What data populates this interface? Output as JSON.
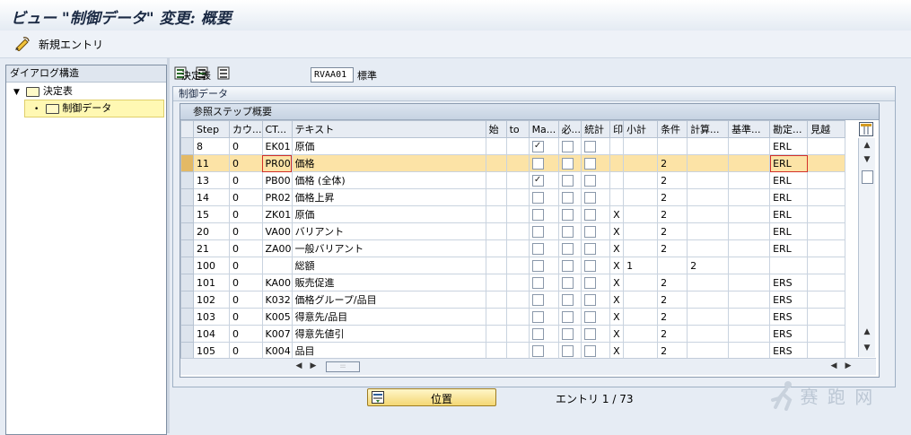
{
  "title": "ビュー \"制御データ\" 変更: 概要",
  "toolbar": {
    "new_entries": "新規エントリ",
    "icons": [
      "edit-pen-icon",
      "copy-icon",
      "delete-icon",
      "undo-icon",
      "select-all-icon",
      "select-block-icon",
      "deselect-all-icon"
    ]
  },
  "tree": {
    "header": "ダイアログ構造",
    "root": "決定表",
    "child": "制御データ"
  },
  "form": {
    "procedure_label": "決定表",
    "procedure_value": "RVAA01",
    "procedure_desc": "標準",
    "group_title": "制御データ",
    "table_title": "参照ステップ概要"
  },
  "table": {
    "columns": [
      "Step",
      "カウ...",
      "CT...",
      "テキスト",
      "始",
      "to",
      "Ma...",
      "必...",
      "統計",
      "印",
      "小計",
      "条件",
      "計算...",
      "基準...",
      "勘定...",
      "見越"
    ],
    "rows": [
      {
        "step": "8",
        "cnt": "0",
        "ct": "EK01",
        "text": "原価",
        "from": "",
        "to": "",
        "ma": true,
        "req": false,
        "stat": false,
        "print": "",
        "sub": "",
        "cond": "",
        "calc": "",
        "base": "",
        "acc": "ERL",
        "accr": "",
        "hl": false
      },
      {
        "step": "11",
        "cnt": "0",
        "ct": "PR00",
        "text": "価格",
        "from": "",
        "to": "",
        "ma": false,
        "req": false,
        "stat": false,
        "print": "",
        "sub": "",
        "cond": "2",
        "calc": "",
        "base": "",
        "acc": "ERL",
        "accr": "",
        "hl": true
      },
      {
        "step": "13",
        "cnt": "0",
        "ct": "PB00",
        "text": "価格 (全体)",
        "from": "",
        "to": "",
        "ma": true,
        "req": false,
        "stat": false,
        "print": "",
        "sub": "",
        "cond": "2",
        "calc": "",
        "base": "",
        "acc": "ERL",
        "accr": "",
        "hl": false
      },
      {
        "step": "14",
        "cnt": "0",
        "ct": "PR02",
        "text": "価格上昇",
        "from": "",
        "to": "",
        "ma": false,
        "req": false,
        "stat": false,
        "print": "",
        "sub": "",
        "cond": "2",
        "calc": "",
        "base": "",
        "acc": "ERL",
        "accr": "",
        "hl": false
      },
      {
        "step": "15",
        "cnt": "0",
        "ct": "ZK01",
        "text": "原価",
        "from": "",
        "to": "",
        "ma": false,
        "req": false,
        "stat": false,
        "print": "X",
        "sub": "",
        "cond": "2",
        "calc": "",
        "base": "",
        "acc": "ERL",
        "accr": "",
        "hl": false
      },
      {
        "step": "20",
        "cnt": "0",
        "ct": "VA00",
        "text": "バリアント",
        "from": "",
        "to": "",
        "ma": false,
        "req": false,
        "stat": false,
        "print": "X",
        "sub": "",
        "cond": "2",
        "calc": "",
        "base": "",
        "acc": "ERL",
        "accr": "",
        "hl": false
      },
      {
        "step": "21",
        "cnt": "0",
        "ct": "ZA00",
        "text": "一般バリアント",
        "from": "",
        "to": "",
        "ma": false,
        "req": false,
        "stat": false,
        "print": "X",
        "sub": "",
        "cond": "2",
        "calc": "",
        "base": "",
        "acc": "ERL",
        "accr": "",
        "hl": false
      },
      {
        "step": "100",
        "cnt": "0",
        "ct": "",
        "text": "総額",
        "from": "",
        "to": "",
        "ma": false,
        "req": false,
        "stat": false,
        "print": "X",
        "sub": "1",
        "cond": "",
        "calc": "2",
        "base": "",
        "acc": "",
        "accr": "",
        "hl": false
      },
      {
        "step": "101",
        "cnt": "0",
        "ct": "KA00",
        "text": "販売促進",
        "from": "",
        "to": "",
        "ma": false,
        "req": false,
        "stat": false,
        "print": "X",
        "sub": "",
        "cond": "2",
        "calc": "",
        "base": "",
        "acc": "ERS",
        "accr": "",
        "hl": false
      },
      {
        "step": "102",
        "cnt": "0",
        "ct": "K032",
        "text": "価格グループ/品目",
        "from": "",
        "to": "",
        "ma": false,
        "req": false,
        "stat": false,
        "print": "X",
        "sub": "",
        "cond": "2",
        "calc": "",
        "base": "",
        "acc": "ERS",
        "accr": "",
        "hl": false
      },
      {
        "step": "103",
        "cnt": "0",
        "ct": "K005",
        "text": "得意先/品目",
        "from": "",
        "to": "",
        "ma": false,
        "req": false,
        "stat": false,
        "print": "X",
        "sub": "",
        "cond": "2",
        "calc": "",
        "base": "",
        "acc": "ERS",
        "accr": "",
        "hl": false
      },
      {
        "step": "104",
        "cnt": "0",
        "ct": "K007",
        "text": "得意先値引",
        "from": "",
        "to": "",
        "ma": false,
        "req": false,
        "stat": false,
        "print": "X",
        "sub": "",
        "cond": "2",
        "calc": "",
        "base": "",
        "acc": "ERS",
        "accr": "",
        "hl": false
      },
      {
        "step": "105",
        "cnt": "0",
        "ct": "K004",
        "text": "品目",
        "from": "",
        "to": "",
        "ma": false,
        "req": false,
        "stat": false,
        "print": "X",
        "sub": "",
        "cond": "2",
        "calc": "",
        "base": "",
        "acc": "ERS",
        "accr": "",
        "hl": false
      }
    ]
  },
  "footer": {
    "position_button": "位置",
    "entry_label": "エントリ",
    "entry_current": "1",
    "entry_sep": "/",
    "entry_total": "73"
  },
  "watermark": "赛 跑 网",
  "colors": {
    "highlight_row": "#fce3a6",
    "annotation_red": "#d2302a",
    "selection_yellow": "#fff8b3"
  }
}
